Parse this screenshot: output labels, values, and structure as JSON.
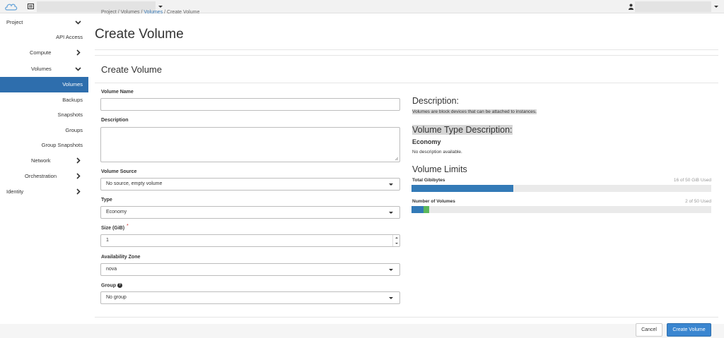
{
  "breadcrumb": {
    "project": "Project",
    "volumes": "Volumes",
    "volumes_link": "Volumes",
    "current": "Create Volume"
  },
  "page": {
    "title": "Create Volume"
  },
  "sidebar": {
    "project": "Project",
    "items": [
      {
        "label": "API Access"
      },
      {
        "label": "Compute"
      },
      {
        "label": "Volumes"
      },
      {
        "label": "Volumes"
      },
      {
        "label": "Backups"
      },
      {
        "label": "Snapshots"
      },
      {
        "label": "Groups"
      },
      {
        "label": "Group Snapshots"
      },
      {
        "label": "Network"
      },
      {
        "label": "Orchestration"
      }
    ],
    "identity": "Identity"
  },
  "form": {
    "title": "Create Volume",
    "volume_name": {
      "label": "Volume Name",
      "value": ""
    },
    "description": {
      "label": "Description",
      "value": ""
    },
    "volume_source": {
      "label": "Volume Source",
      "value": "No source, empty volume"
    },
    "type": {
      "label": "Type",
      "value": "Economy"
    },
    "size": {
      "label": "Size (GiB)",
      "required_mark": "*",
      "value": "1"
    },
    "availability_zone": {
      "label": "Availability Zone",
      "value": "nova"
    },
    "group": {
      "label": "Group",
      "value": "No group",
      "help": "?"
    }
  },
  "info": {
    "desc_heading": "Description:",
    "desc_text": "Volumes are block devices that can be attached to instances.",
    "vtd_heading": "Volume Type Description:",
    "vt_name": "Economy",
    "vt_desc": "No description available.",
    "limits_heading": "Volume Limits",
    "gib": {
      "label": "Total Gibibytes",
      "used_text": "16 of 50 GiB Used",
      "used": 16,
      "total": 50,
      "added": 1
    },
    "volumes": {
      "label": "Number of Volumes",
      "used_text": "2 of 50 Used",
      "used": 2,
      "total": 50,
      "added": 1
    }
  },
  "buttons": {
    "cancel": "Cancel",
    "create": "Create Volume"
  },
  "colors": {
    "accent": "#2e6ead",
    "bar_used": "#337ab7",
    "bar_added": "#5cb85c"
  }
}
